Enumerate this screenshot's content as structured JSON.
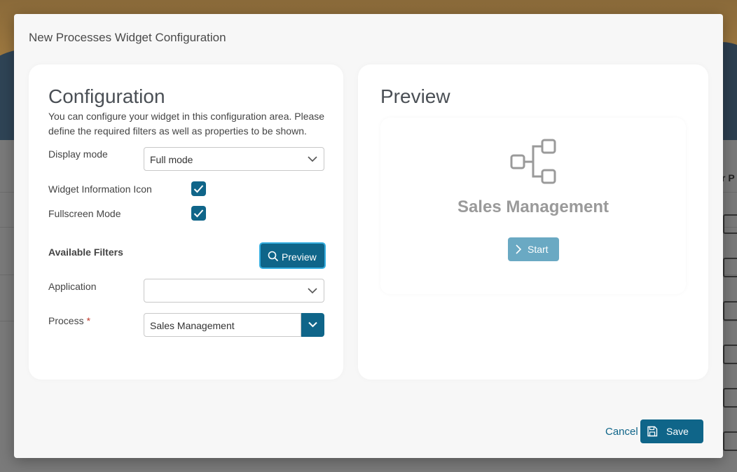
{
  "background": {
    "right_partial_text": "r P"
  },
  "dialog": {
    "title": "New Processes Widget Configuration",
    "cancel_label": "Cancel",
    "save_label": "Save",
    "save_icon": "floppy-disk-icon"
  },
  "config": {
    "heading": "Configuration",
    "description": "You can configure your widget in this configuration area. Please define the required filters as well as properties to be shown.",
    "display_mode": {
      "label": "Display mode",
      "value": "Full mode"
    },
    "widget_info_icon": {
      "label": "Widget Information Icon",
      "checked": true
    },
    "fullscreen_mode": {
      "label": "Fullscreen Mode",
      "checked": true
    },
    "available_filters_label": "Available Filters",
    "preview_button_label": "Preview",
    "preview_button_icon": "search-icon",
    "application": {
      "label": "Application",
      "value": ""
    },
    "process": {
      "label": "Process",
      "required_mark": "*",
      "value": "Sales Management"
    }
  },
  "preview": {
    "heading": "Preview",
    "widget_icon": "process-flow-icon",
    "process_name": "Sales Management",
    "start_label": "Start",
    "start_icon": "chevron-right-icon"
  },
  "colors": {
    "primary": "#0f6589",
    "focus_ring": "#35aee0",
    "start_button": "#6aa9c3",
    "required": "#c0392b"
  }
}
